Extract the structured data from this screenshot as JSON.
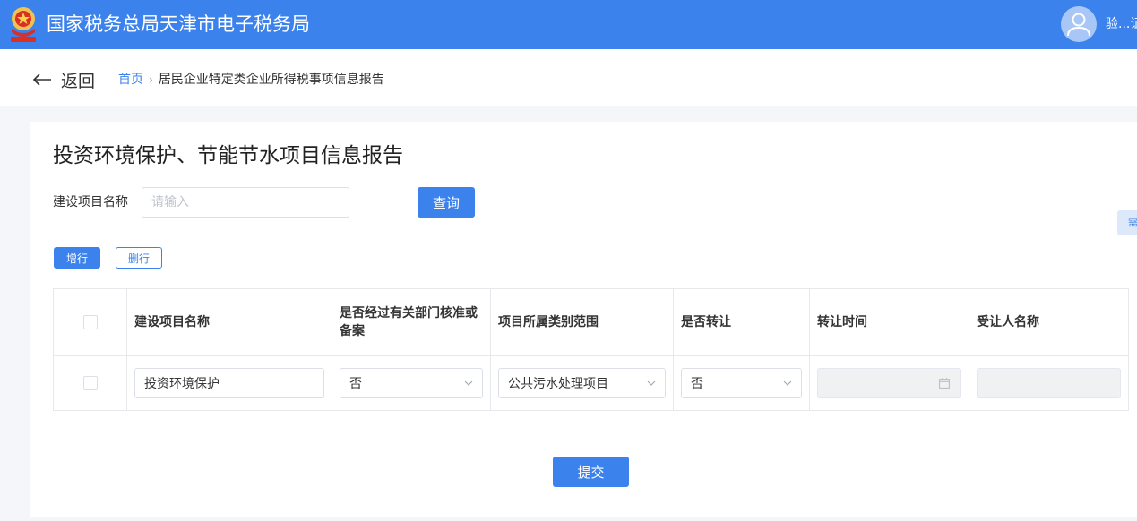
{
  "header": {
    "site_title": "国家税务总局天津市电子税务局",
    "user_name": "验...证",
    "emblem_icon": "tax-emblem-icon",
    "avatar_icon": "user-avatar-icon"
  },
  "nav": {
    "back_label": "返回",
    "breadcrumb_home": "首页",
    "breadcrumb_separator": "›",
    "breadcrumb_current": "居民企业特定类企业所得税事项信息报告"
  },
  "main": {
    "title": "投资环境保护、节能节水项目信息报告",
    "filter_label": "建设项目名称",
    "filter_placeholder": "请输入",
    "query_button": "查询",
    "side_tab_label": "需",
    "add_row_button": "增行",
    "delete_row_button": "删行",
    "submit_button": "提交"
  },
  "table": {
    "headers": [
      "建设项目名称",
      "是否经过有关部门核准或备案",
      "项目所属类别范围",
      "是否转让",
      "转让时间",
      "受让人名称"
    ],
    "rows": [
      {
        "project_name": "投资环境保护",
        "approved": "否",
        "category": "公共污水处理项目",
        "transferred": "否",
        "transfer_time": "",
        "transferee": ""
      }
    ]
  },
  "colors": {
    "primary": "#3b82ec",
    "page_background": "#f4f6f9",
    "border": "#dcdfe6",
    "disabled_fill": "#f0f1f3"
  }
}
